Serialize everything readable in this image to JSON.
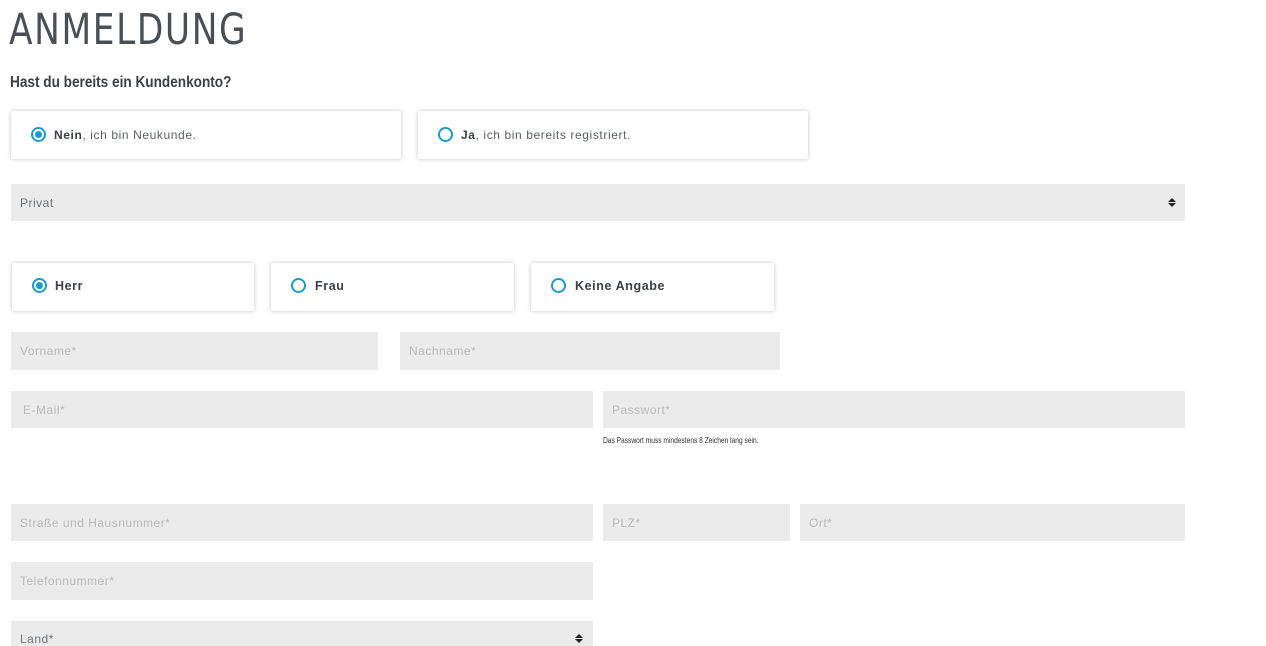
{
  "page": {
    "title": "ANMELDUNG",
    "question": "Hast du bereits ein Kundenkonto?"
  },
  "account_choice": {
    "options": [
      {
        "bold": "Nein",
        "rest": ", ich bin Neukunde.",
        "checked": true
      },
      {
        "bold": "Ja",
        "rest": ", ich bin bereits registriert.",
        "checked": false
      }
    ]
  },
  "customer_type": {
    "selected": "Privat"
  },
  "salutation": {
    "options": [
      {
        "label": "Herr",
        "checked": true
      },
      {
        "label": "Frau",
        "checked": false
      },
      {
        "label": "Keine Angabe",
        "checked": false
      }
    ]
  },
  "fields": {
    "first_name": {
      "placeholder": "Vorname*",
      "value": ""
    },
    "last_name": {
      "placeholder": "Nachname*",
      "value": ""
    },
    "email": {
      "placeholder": "E-Mail*",
      "value": ""
    },
    "password": {
      "placeholder": "Passwort*",
      "value": ""
    },
    "password_hint": "Das Passwort muss mindestens 8 Zeichen lang sein.",
    "street": {
      "placeholder": "Straße und Hausnummer*",
      "value": ""
    },
    "zip": {
      "placeholder": "PLZ*",
      "value": ""
    },
    "city": {
      "placeholder": "Ort*",
      "value": ""
    },
    "phone": {
      "placeholder": "Telefonnummer*",
      "value": ""
    }
  },
  "country": {
    "selected": "Land*"
  },
  "colors": {
    "accent": "#1a9bc9",
    "field_background": "#ebebeb",
    "text": "#3c4147",
    "placeholder": "#b9b9b9"
  },
  "icons": {
    "radio_checked": "radio-checked-icon",
    "radio_unchecked": "radio-unchecked-icon",
    "select_arrows": "sort-arrows-icon"
  }
}
